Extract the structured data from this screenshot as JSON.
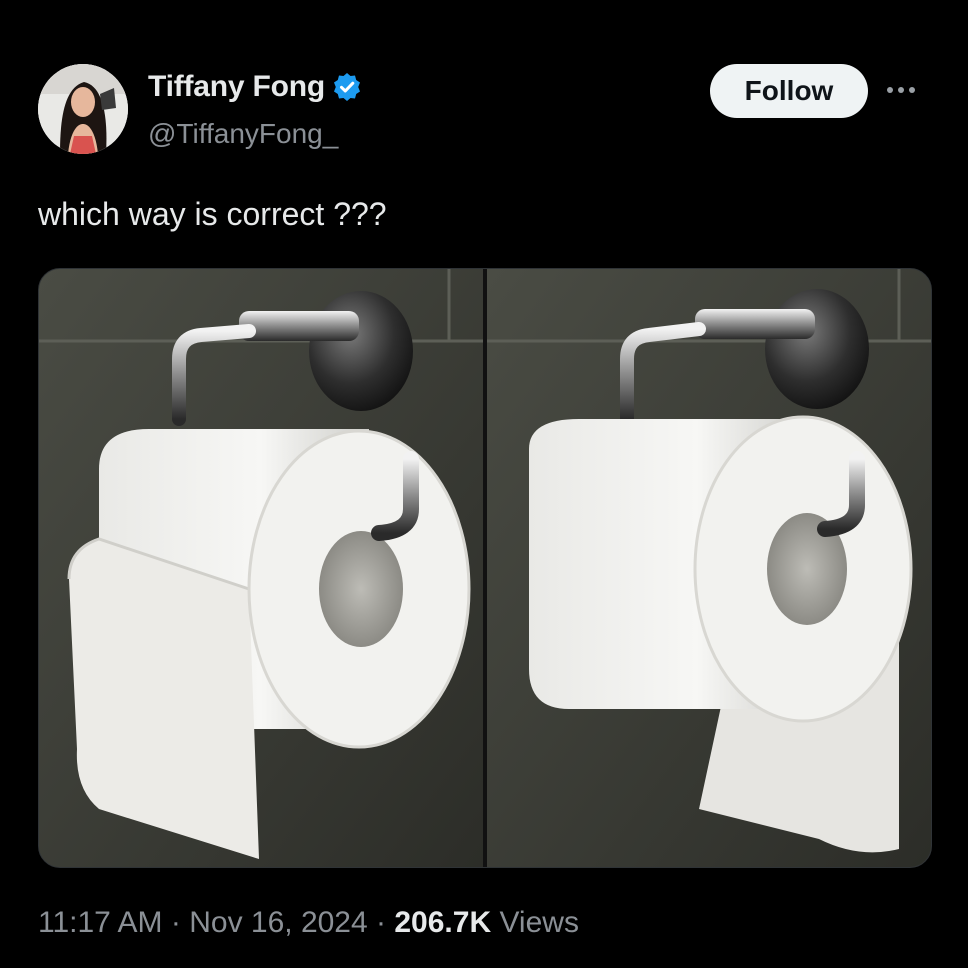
{
  "user": {
    "display_name": "Tiffany Fong",
    "handle": "@TiffanyFong_",
    "verified": true,
    "verified_color": "#1d9bf0"
  },
  "actions": {
    "follow_label": "Follow"
  },
  "tweet": {
    "text": "which way is correct ???"
  },
  "meta": {
    "time": "11:17 AM",
    "separator": "·",
    "date": "Nov 16, 2024",
    "views_count": "206.7K",
    "views_label": "Views"
  },
  "media": {
    "description_icons": [
      "toilet-paper-over",
      "toilet-paper-under"
    ]
  },
  "colors": {
    "background": "#000000",
    "text_primary": "#e7e9ea",
    "text_secondary": "#8b9096",
    "follow_bg": "#eff3f4",
    "follow_text": "#0f1419"
  }
}
